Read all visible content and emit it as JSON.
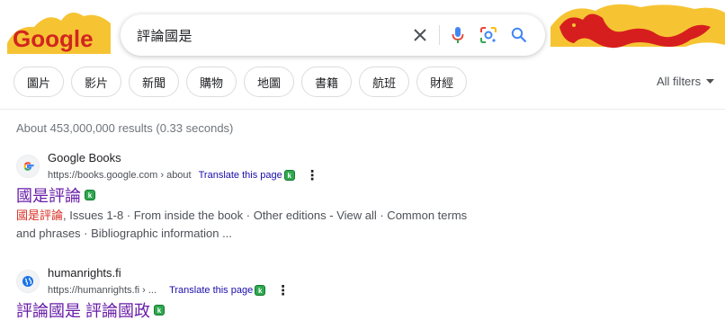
{
  "search": {
    "query": "評論國是",
    "clear_label": "×"
  },
  "logo": {
    "text": "Google"
  },
  "chips": [
    "圖片",
    "影片",
    "新聞",
    "購物",
    "地圖",
    "書籍",
    "航班",
    "財經"
  ],
  "all_filters": "All filters",
  "stats": "About 453,000,000 results (0.33 seconds)",
  "results": [
    {
      "site_name": "Google Books",
      "url": "https://books.google.com › about",
      "translate": "Translate this page",
      "title": "國是評論",
      "snippet_em": "國是評論",
      "snippet_rest": ", Issues 1-8 · From inside the book · Other editions - View all · Common terms and phrases · Bibliographic information ..."
    },
    {
      "site_name": "humanrights.fi",
      "url": "https://humanrights.fi › ...",
      "translate": "Translate this page",
      "title": "評論國是 評論國政"
    }
  ],
  "colors": {
    "link_visited": "#681da8",
    "translate_link": "#1a0dab",
    "highlight": "#d93025",
    "badge_green": "#2fa84f"
  }
}
